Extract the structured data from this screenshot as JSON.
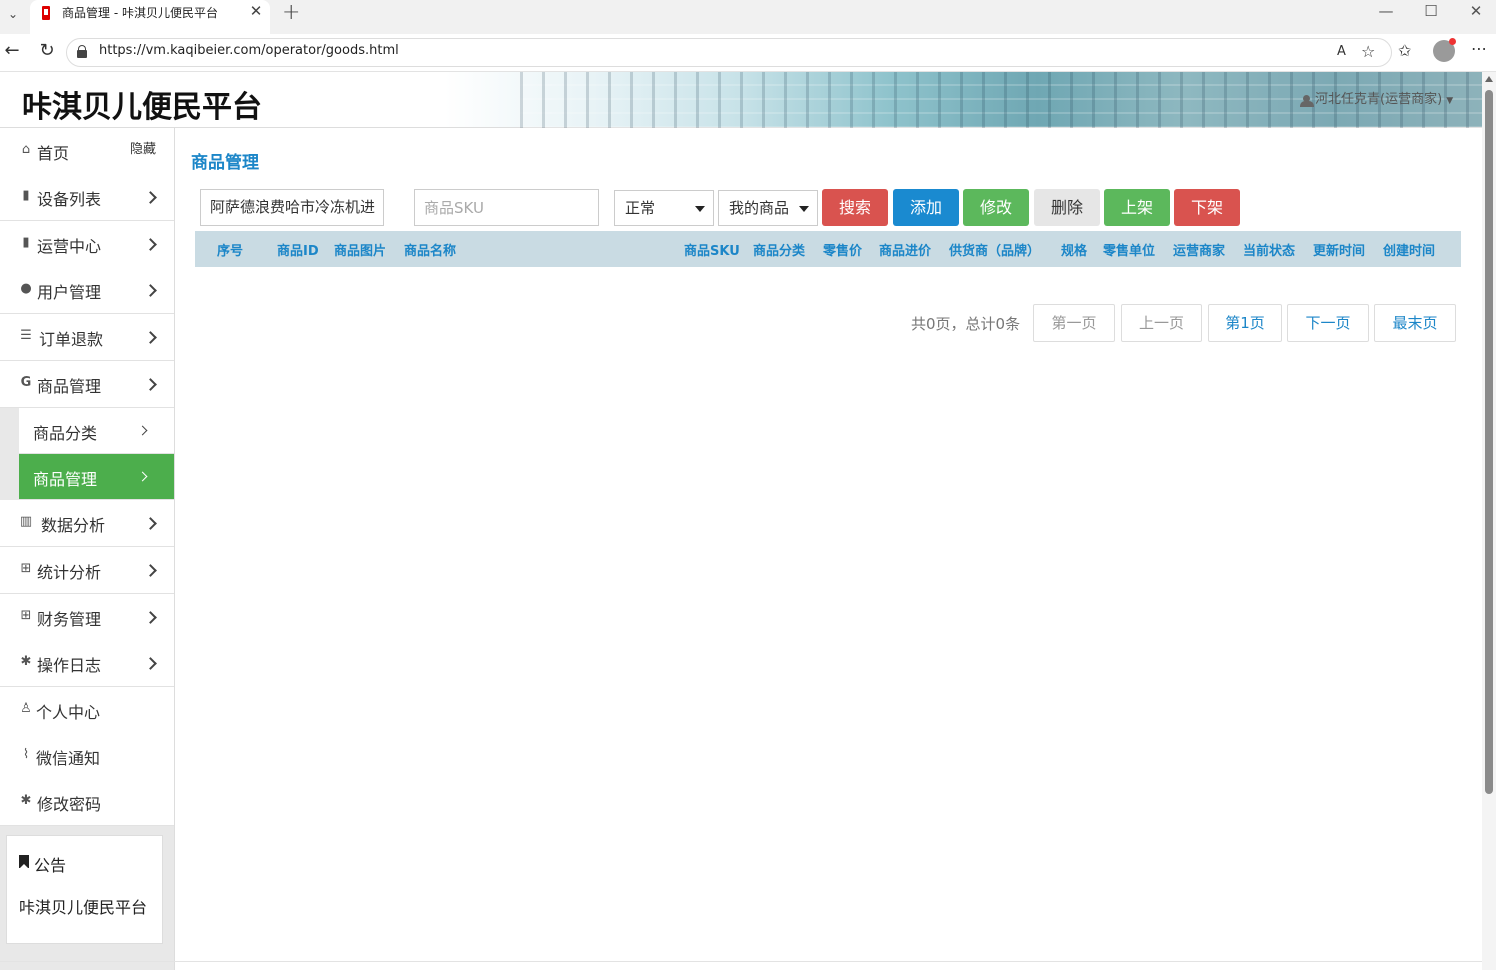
{
  "browser": {
    "tab_title": "商品管理 - 咔淇贝儿便民平台",
    "url": "https://vm.kaqibeier.com/operator/goods.html"
  },
  "header": {
    "site_title": "咔淇贝儿便民平台",
    "user_label": "河北任克青(运营商家)"
  },
  "sidebar": {
    "hide_label": "隐藏",
    "items": [
      {
        "label": "首页",
        "icon": "home-icon"
      },
      {
        "label": "设备列表",
        "icon": "device-icon"
      },
      {
        "label": "运营中心",
        "icon": "device-icon"
      },
      {
        "label": "用户管理",
        "icon": "user-icon"
      },
      {
        "label": "订单退款",
        "icon": "list-icon"
      },
      {
        "label": "商品管理",
        "icon": "g-icon"
      },
      {
        "label": "数据分析",
        "icon": "bar-chart-icon"
      },
      {
        "label": "统计分析",
        "icon": "table-icon"
      },
      {
        "label": "财务管理",
        "icon": "table-icon"
      },
      {
        "label": "操作日志",
        "icon": "gear-icon"
      },
      {
        "label": "个人中心",
        "icon": "user-tie-icon"
      },
      {
        "label": "微信通知",
        "icon": "rss-icon"
      },
      {
        "label": "修改密码",
        "icon": "gear-icon"
      }
    ],
    "sub_items": [
      {
        "label": "商品分类"
      },
      {
        "label": "商品管理"
      }
    ],
    "notice": {
      "title": "公告",
      "body": "咔淇贝儿便民平台"
    }
  },
  "main": {
    "title": "商品管理",
    "filters": {
      "name_value": "阿萨德浪费哈市冷冻机进",
      "sku_placeholder": "商品SKU",
      "status_selected": "正常",
      "scope_selected": "我的商品"
    },
    "buttons": {
      "search": "搜索",
      "add": "添加",
      "edit": "修改",
      "delete": "删除",
      "shelve": "上架",
      "unshelve": "下架"
    },
    "columns": [
      "序号",
      "商品ID",
      "商品图片",
      "商品名称",
      "商品SKU",
      "商品分类",
      "零售价",
      "商品进价",
      "供货商（品牌）",
      "规格",
      "零售单位",
      "运营商家",
      "当前状态",
      "更新时间",
      "创建时间"
    ],
    "rows": [],
    "pagination": {
      "info": "共0页，总计0条",
      "first": "第一页",
      "prev": "上一页",
      "current": "第1页",
      "next": "下一页",
      "last": "最末页"
    }
  },
  "colors": {
    "accent_blue": "#1c86c8",
    "active_green": "#4cae4c",
    "danger_red": "#d9534f",
    "primary_blue": "#1a8ad0",
    "success_green": "#5cb85c"
  }
}
